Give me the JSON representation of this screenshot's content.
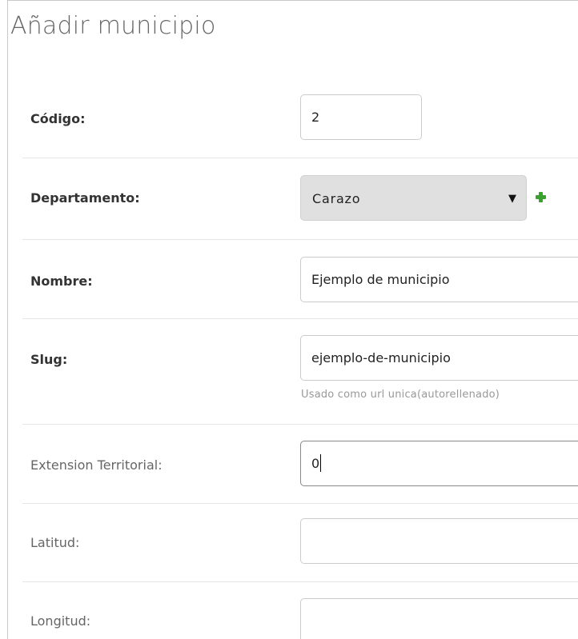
{
  "page": {
    "title": "Añadir municipio"
  },
  "fields": {
    "codigo": {
      "label": "Código:",
      "value": "2"
    },
    "departamento": {
      "label": "Departamento:",
      "selected": "Carazo",
      "caret": "▼"
    },
    "nombre": {
      "label": "Nombre:",
      "value": "Ejemplo de municipio"
    },
    "slug": {
      "label": "Slug:",
      "value": "ejemplo-de-municipio",
      "help": "Usado como url unica(autorellenado)"
    },
    "extension": {
      "label": "Extension Territorial:",
      "value": "0"
    },
    "latitud": {
      "label": "Latitud:",
      "value": ""
    },
    "longitud": {
      "label": "Longitud:",
      "value": ""
    }
  },
  "icons": {
    "add": "plus-icon",
    "spinner": "number-spinner-icon"
  },
  "colors": {
    "add_icon": "#3aa02e",
    "select_bg": "#e0e0e0",
    "title": "#666666",
    "help_text": "#999999"
  }
}
